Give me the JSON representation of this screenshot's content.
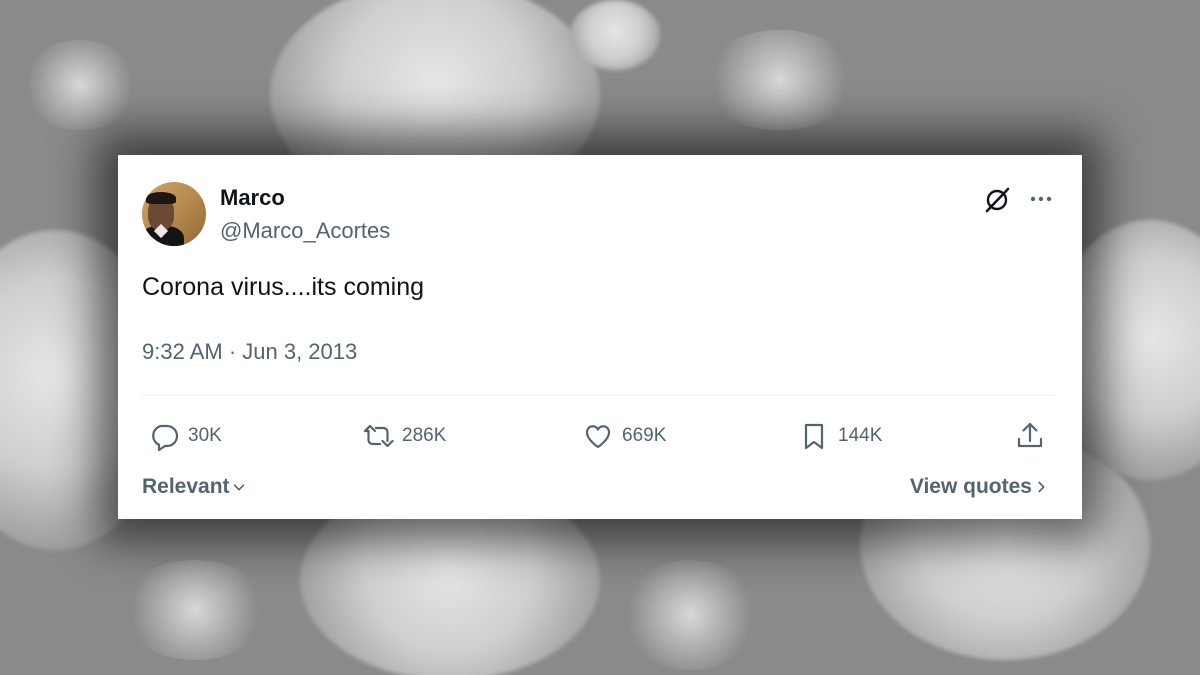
{
  "tweet": {
    "author_name": "Marco",
    "author_handle": "@Marco_Acortes",
    "text": "Corona virus....its coming",
    "timestamp": "9:32 AM · Jun 3, 2013"
  },
  "actions": {
    "replies": "30K",
    "reposts": "286K",
    "likes": "669K",
    "bookmarks": "144K"
  },
  "footer": {
    "sort_label": "Relevant",
    "view_quotes_label": "View quotes"
  },
  "icons": {
    "top_right": [
      "grok-icon",
      "more-options-icon"
    ],
    "actions": [
      "reply-icon",
      "repost-icon",
      "like-icon",
      "bookmark-icon",
      "share-icon"
    ],
    "footer": [
      "chevron-down-icon",
      "chevron-right-icon"
    ]
  },
  "colors": {
    "text_primary": "#0f1419",
    "text_secondary": "#536471",
    "card_background": "#ffffff",
    "page_background": "#8a8a8a"
  }
}
